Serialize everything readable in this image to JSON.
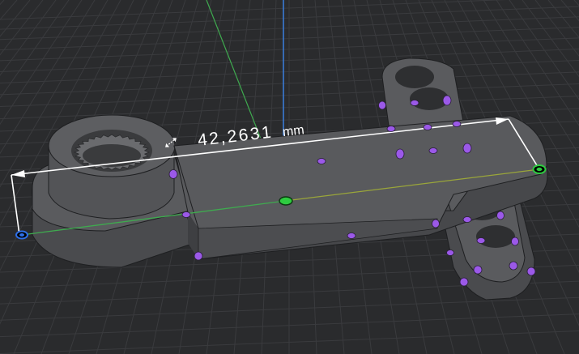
{
  "viewport": {
    "measurement": {
      "value": "42,2631",
      "unit": "mm"
    }
  },
  "colors": {
    "background": "#2a2b2d",
    "grid_line": "#3a3b3e",
    "axis_green": "#3faa4f",
    "axis_blue": "#3a7fe0",
    "model_top": "#595a5d",
    "model_side": "#48494c",
    "snap_point": "#9b59e8",
    "endpoint_green": "#2ecc40",
    "endpoint_blue": "#2d6fe8",
    "dimension_line": "#ffffff"
  },
  "icons": {
    "measure_cursor": "double-arrow-cursor-icon"
  }
}
